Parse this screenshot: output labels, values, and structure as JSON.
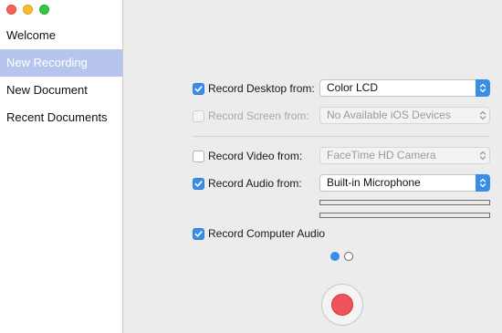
{
  "window": {
    "traffic_lights": {
      "close": "#fc5f57",
      "minimize": "#fdbc2e",
      "zoom": "#33c748"
    }
  },
  "sidebar": {
    "selected_color": "#b7c4ee",
    "items": [
      {
        "label": "Welcome",
        "selected": false
      },
      {
        "label": "New Recording",
        "selected": true
      },
      {
        "label": "New Document",
        "selected": false
      },
      {
        "label": "Recent Documents",
        "selected": false
      }
    ]
  },
  "main": {
    "record_desktop": {
      "label": "Record Desktop from:",
      "checked": true,
      "enabled": true,
      "value": "Color LCD"
    },
    "record_screen": {
      "label": "Record Screen from:",
      "checked": false,
      "enabled": false,
      "value": "No Available iOS Devices"
    },
    "record_video": {
      "label": "Record Video from:",
      "checked": false,
      "enabled": true,
      "value": "FaceTime HD Camera",
      "popup_enabled": false
    },
    "record_audio": {
      "label": "Record Audio from:",
      "checked": true,
      "enabled": true,
      "value": "Built-in Microphone"
    },
    "record_computer_audio": {
      "label": "Record Computer Audio",
      "checked": true,
      "enabled": true
    },
    "audio_levels": [
      0.0,
      0.0
    ],
    "pages": {
      "count": 2,
      "current": 1
    },
    "accent_color": "#3a8ee6",
    "record_button_color": "#f0545a"
  }
}
